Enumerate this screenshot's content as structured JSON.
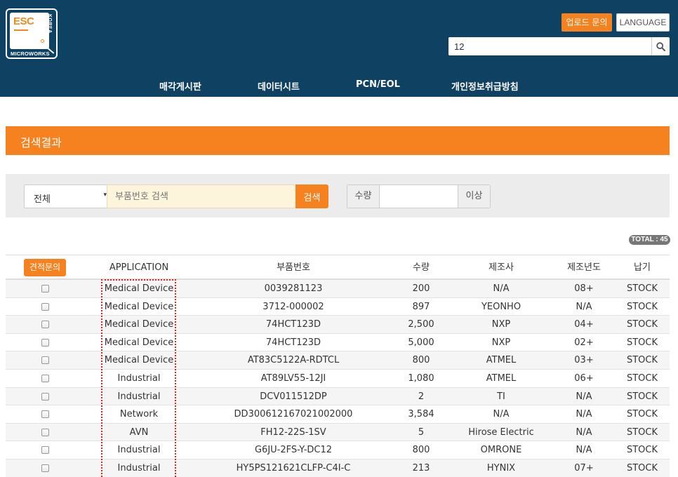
{
  "header": {
    "logo": {
      "brand": "ESC",
      "side_text": "KOREA",
      "bottom_text": "MICROWORKS"
    },
    "upload_inquiry_label": "업로드 문의",
    "language_label": "LANGUAGE",
    "search": {
      "value": "12",
      "icon": "search-icon"
    },
    "nav": [
      "매각게시판",
      "데이터시트",
      "PCN/EOL",
      "개인정보취급방침"
    ],
    "bg_color": "#0f4163"
  },
  "section": {
    "title": "검색결과",
    "color": "#f5821f"
  },
  "filter": {
    "category_selected": "전체",
    "part_placeholder": "부품번호 검색",
    "search_label": "검색",
    "qty_label": "수량",
    "qty_value": "",
    "qty_suffix": "이상"
  },
  "total_badge": "TOTAL : 45",
  "table": {
    "quote_button": "견적문의",
    "columns": [
      "APPLICATION",
      "부품번호",
      "수량",
      "제조사",
      "제조년도",
      "납기"
    ],
    "rows": [
      {
        "application": "Medical Device",
        "part": "0039281123",
        "qty": "200",
        "mfr": "N/A",
        "year": "08+",
        "delivery": "STOCK"
      },
      {
        "application": "Medical Device",
        "part": "3712-000002",
        "qty": "897",
        "mfr": "YEONHO",
        "year": "N/A",
        "delivery": "STOCK"
      },
      {
        "application": "Medical Device",
        "part": "74HCT123D",
        "qty": "2,500",
        "mfr": "NXP",
        "year": "04+",
        "delivery": "STOCK"
      },
      {
        "application": "Medical Device",
        "part": "74HCT123D",
        "qty": "5,000",
        "mfr": "NXP",
        "year": "02+",
        "delivery": "STOCK"
      },
      {
        "application": "Medical Device",
        "part": "AT83C5122A-RDTCL",
        "qty": "800",
        "mfr": "ATMEL",
        "year": "03+",
        "delivery": "STOCK"
      },
      {
        "application": "Industrial",
        "part": "AT89LV55-12JI",
        "qty": "1,080",
        "mfr": "ATMEL",
        "year": "06+",
        "delivery": "STOCK"
      },
      {
        "application": "Industrial",
        "part": "DCV011512DP",
        "qty": "2",
        "mfr": "TI",
        "year": "N/A",
        "delivery": "STOCK"
      },
      {
        "application": "Network",
        "part": "DD300612167021002000",
        "qty": "3,584",
        "mfr": "N/A",
        "year": "N/A",
        "delivery": "STOCK"
      },
      {
        "application": "AVN",
        "part": "FH12-22S-1SV",
        "qty": "5",
        "mfr": "Hirose Electric",
        "year": "N/A",
        "delivery": "STOCK"
      },
      {
        "application": "Industrial",
        "part": "G6JU-2FS-Y-DC12",
        "qty": "800",
        "mfr": "OMRONE",
        "year": "N/A",
        "delivery": "STOCK"
      },
      {
        "application": "Industrial",
        "part": "HY5PS121621CLFP-C4I-C",
        "qty": "213",
        "mfr": "HYNIX",
        "year": "07+",
        "delivery": "STOCK"
      }
    ]
  },
  "annotation": {
    "color": "#e0251b"
  }
}
